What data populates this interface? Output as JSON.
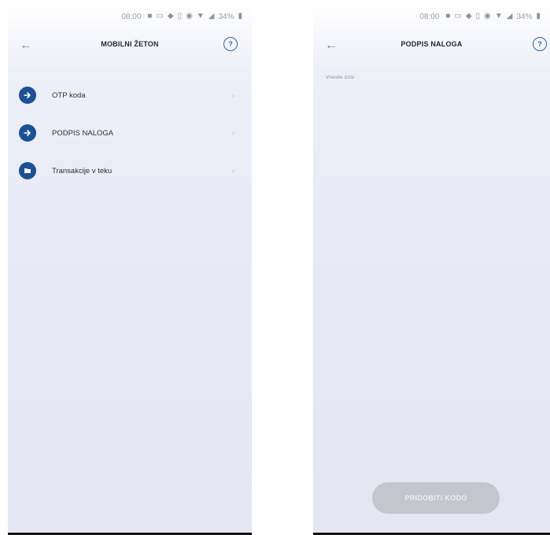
{
  "left_screen": {
    "status_bar": {
      "time": "08:00",
      "battery": "34%"
    },
    "header": {
      "title": "MOBILNI ŽETON"
    },
    "menu": [
      {
        "label": "OTP koda",
        "icon": "arrow-right-icon"
      },
      {
        "label": "PODPIS NALOGA",
        "icon": "arrow-right-icon"
      },
      {
        "label": "Transakcije v teku",
        "icon": "folder-icon"
      }
    ]
  },
  "right_screen": {
    "status_bar": {
      "time": "08:00",
      "battery": "34%"
    },
    "header": {
      "title": "PODPIS NALOGA"
    },
    "hint": "Vnesite izziv",
    "button": {
      "label": "PRIDOBITI KODO"
    }
  },
  "colors": {
    "accent": "#1b5297",
    "help": "#2a64b0",
    "button_disabled": "#c3c6cc"
  }
}
